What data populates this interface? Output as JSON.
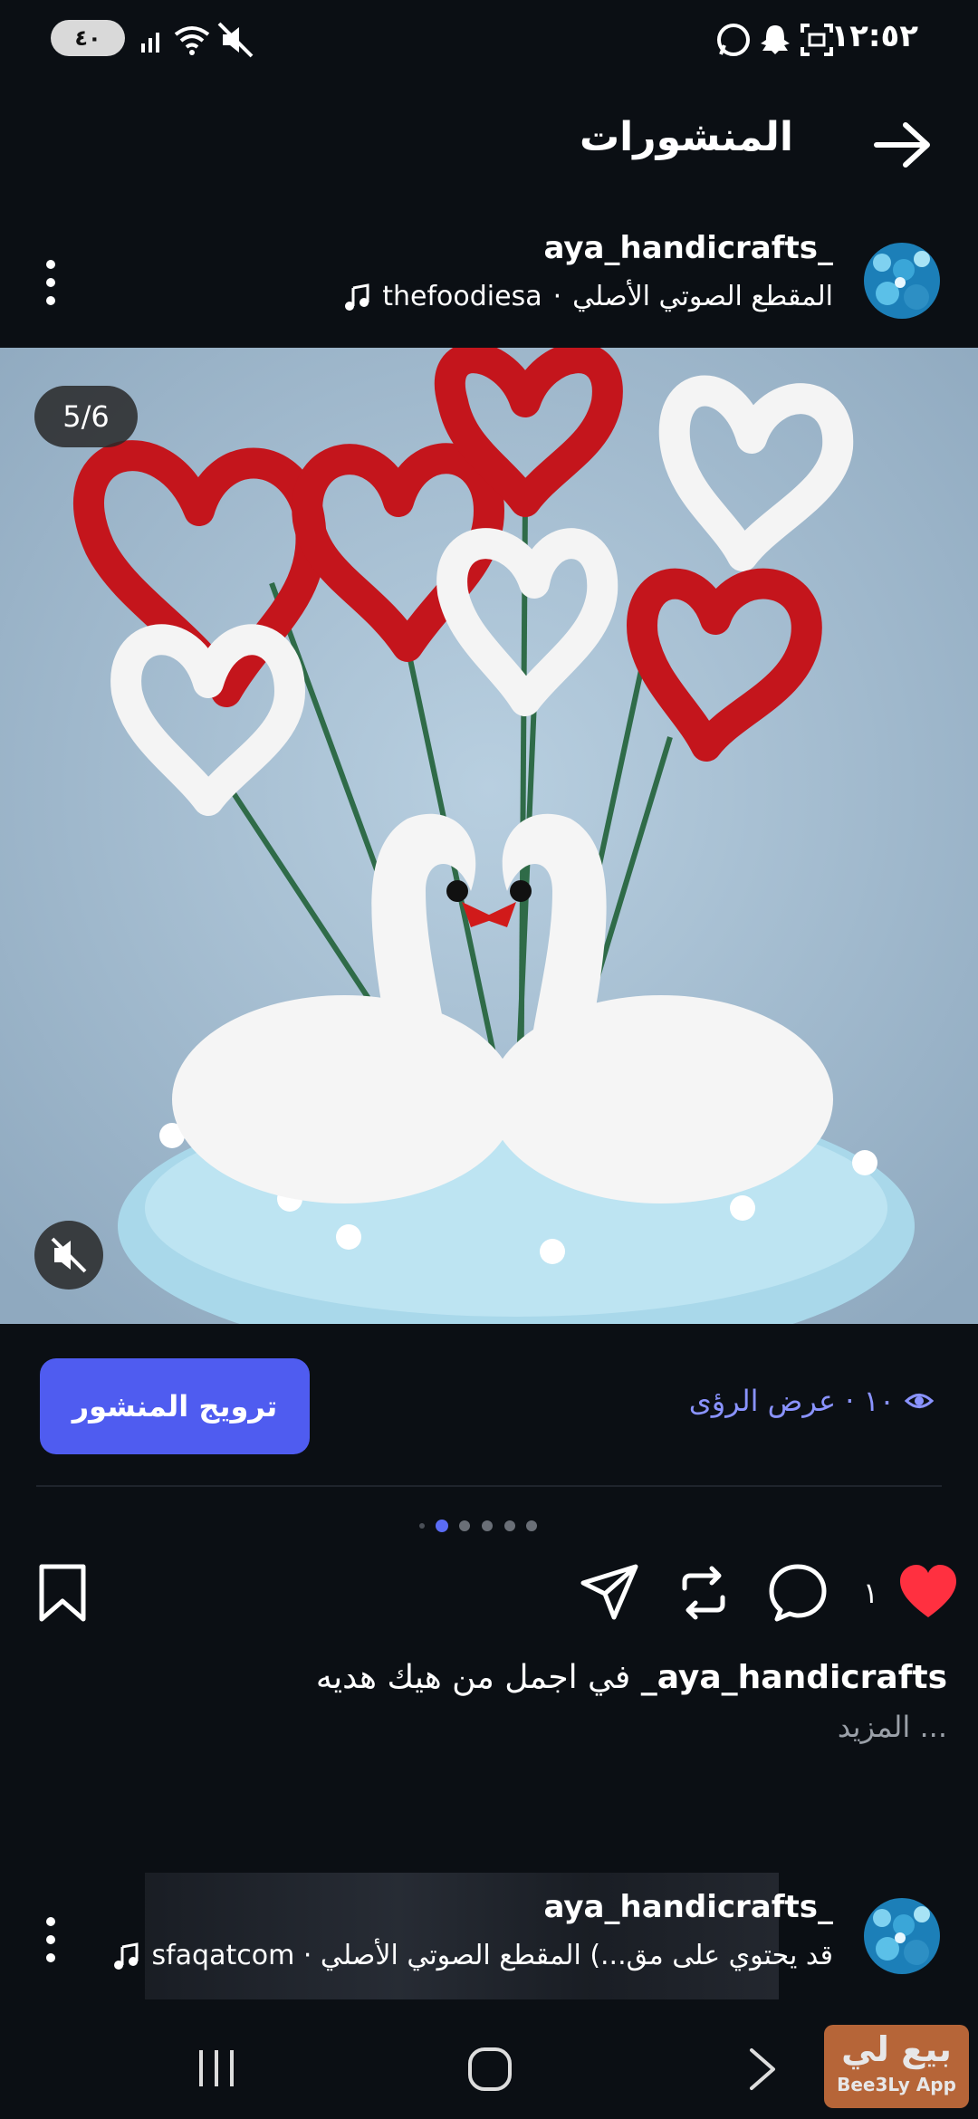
{
  "status_bar": {
    "time": "١٢:٥٢",
    "battery": "٤٠"
  },
  "header": {
    "title": "المنشورات"
  },
  "post": {
    "username": "aya_handicrafts_",
    "audio_author": "thefoodiesa",
    "audio_label": "المقطع الصوتي الأصلي",
    "media_counter": "5/6",
    "promote_label": "ترويج المنشور",
    "views_label": "١٠ · عرض الرؤى",
    "likes_count": "١",
    "caption_user": "aya_handicrafts_",
    "caption_text": "في اجمل من هيك هديه",
    "more_label": "... المزيد",
    "carousel_total": 6,
    "carousel_active": 5
  },
  "post2": {
    "username": "aya_handicrafts_",
    "audio_line": "قد يحتوي على مق...) المقطع الصوتي الأصلي · sfaqatcom"
  },
  "watermark": {
    "title": "بيع لي",
    "subtitle": "Bee3Ly App"
  },
  "colors": {
    "background": "#0b0f14",
    "accent": "#4f5cf0",
    "views": "#8a93ff",
    "like": "#ff3040"
  }
}
